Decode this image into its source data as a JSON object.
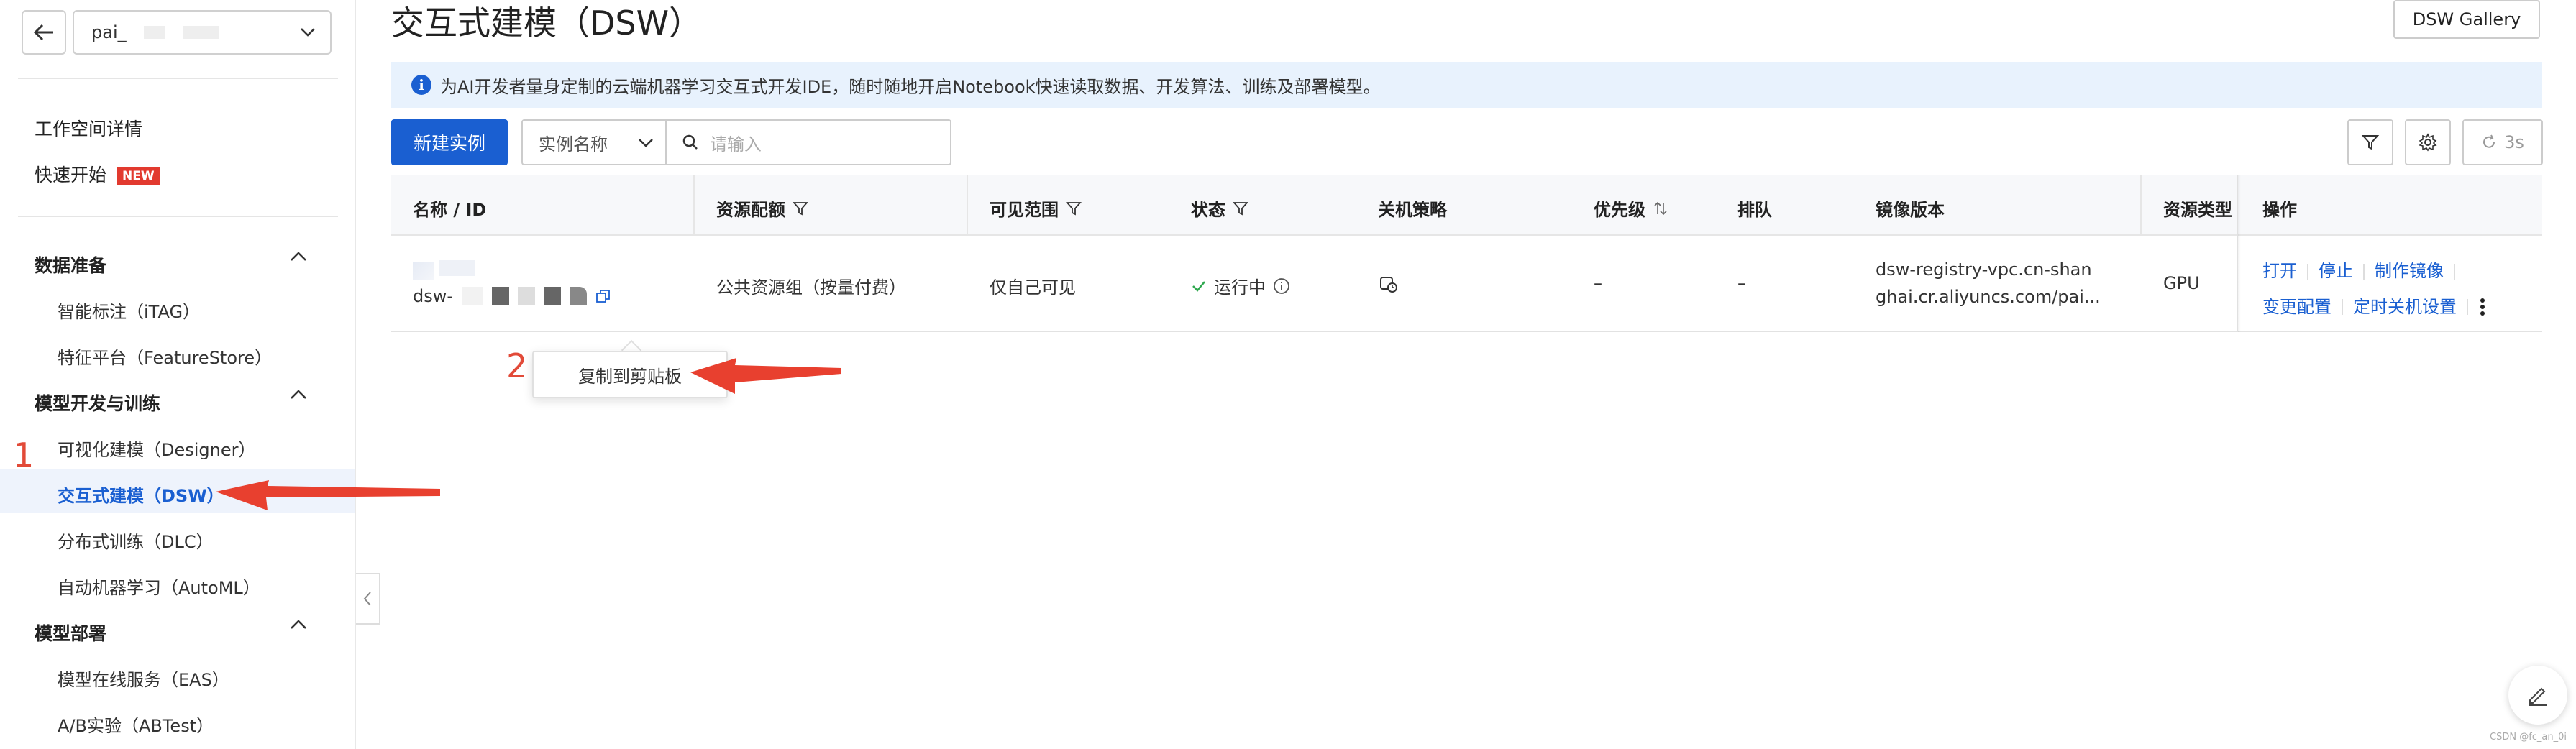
{
  "sidebar": {
    "workspace_name": "pai_",
    "items": {
      "workspace_detail": "工作空间详情",
      "quick_start": "快速开始",
      "new_badge": "NEW"
    },
    "groups": {
      "data_prep": {
        "label": "数据准备",
        "items": [
          "智能标注（iTAG）",
          "特征平台（FeatureStore）"
        ]
      },
      "model_dev": {
        "label": "模型开发与训练",
        "items": [
          "可视化建模（Designer）",
          "交互式建模（DSW）",
          "分布式训练（DLC）",
          "自动机器学习（AutoML）"
        ]
      },
      "model_deploy": {
        "label": "模型部署",
        "items": [
          "模型在线服务（EAS）",
          "A/B实验（ABTest）"
        ]
      }
    }
  },
  "header": {
    "title": "交互式建模（DSW）",
    "gallery_button": "DSW Gallery"
  },
  "info_bar": {
    "text": "为AI开发者量身定制的云端机器学习交互式开发IDE，随时随地开启Notebook快速读取数据、开发算法、训练及部署模型。"
  },
  "toolbar": {
    "new_button": "新建实例",
    "filter_field": "实例名称",
    "search_placeholder": "请输入",
    "refresh_label": "3s"
  },
  "table": {
    "columns": [
      "名称 / ID",
      "资源配额",
      "可见范围",
      "状态",
      "关机策略",
      "优先级",
      "排队",
      "镜像版本",
      "资源类型",
      "操作"
    ],
    "rows": [
      {
        "id_prefix": "dsw-",
        "quota": "公共资源组（按量付费）",
        "visibility": "仅自己可见",
        "status": "运行中",
        "priority": "–",
        "queue": "–",
        "image_line1": "dsw-registry-vpc.cn-shan",
        "image_line2": "ghai.cr.aliyuncs.com/pai...",
        "resource_type": "GPU",
        "actions_row1": [
          "打开",
          "停止",
          "制作镜像"
        ],
        "actions_row2": [
          "变更配置",
          "定时关机设置"
        ]
      }
    ]
  },
  "tooltip": {
    "text": "复制到剪贴板"
  },
  "annotations": {
    "one": "1",
    "two": "2"
  },
  "watermark": "CSDN @fc_an_0i",
  "colors": {
    "accent": "#1a5fd1",
    "annotation": "#e24a38",
    "status_ok": "#2fa84f",
    "badge": "#e23a2f"
  }
}
